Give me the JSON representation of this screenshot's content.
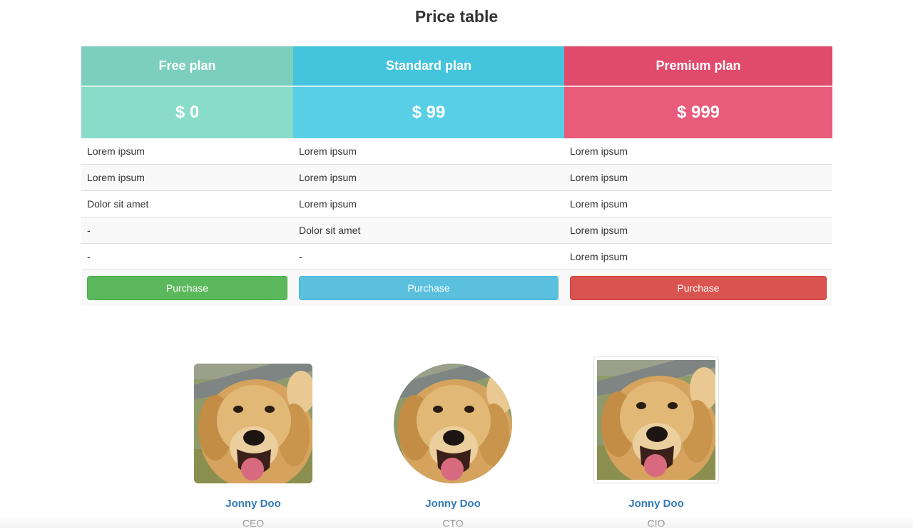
{
  "page": {
    "title": "Price table"
  },
  "colors": {
    "free_head": "#7ccfbd",
    "free_price": "#88dcc8",
    "standard_head": "#45c4dd",
    "standard_price": "#58cfe6",
    "premium_head": "#e04a6b",
    "premium_price": "#e95b7a"
  },
  "plans": [
    {
      "name": "Free plan",
      "price": "$ 0",
      "button": "Purchase"
    },
    {
      "name": "Standard plan",
      "price": "$ 99",
      "button": "Purchase"
    },
    {
      "name": "Premium plan",
      "price": "$ 999",
      "button": "Purchase"
    }
  ],
  "features": [
    [
      "Lorem ipsum",
      "Lorem ipsum",
      "Lorem ipsum"
    ],
    [
      "Lorem ipsum",
      "Lorem ipsum",
      "Lorem ipsum"
    ],
    [
      "Dolor sit amet",
      "Lorem ipsum",
      "Lorem ipsum"
    ],
    [
      "-",
      "Dolor sit amet",
      "Lorem ipsum"
    ],
    [
      "-",
      "-",
      "Lorem ipsum"
    ]
  ],
  "team": [
    {
      "name": "Jonny Doo",
      "role": "CEO",
      "photo_style": "rounded",
      "icon": "dog-photo"
    },
    {
      "name": "Jonny Doo",
      "role": "CTO",
      "photo_style": "circle",
      "icon": "dog-photo"
    },
    {
      "name": "Jonny Doo",
      "role": "CIO",
      "photo_style": "thumbnail",
      "icon": "dog-photo"
    }
  ]
}
